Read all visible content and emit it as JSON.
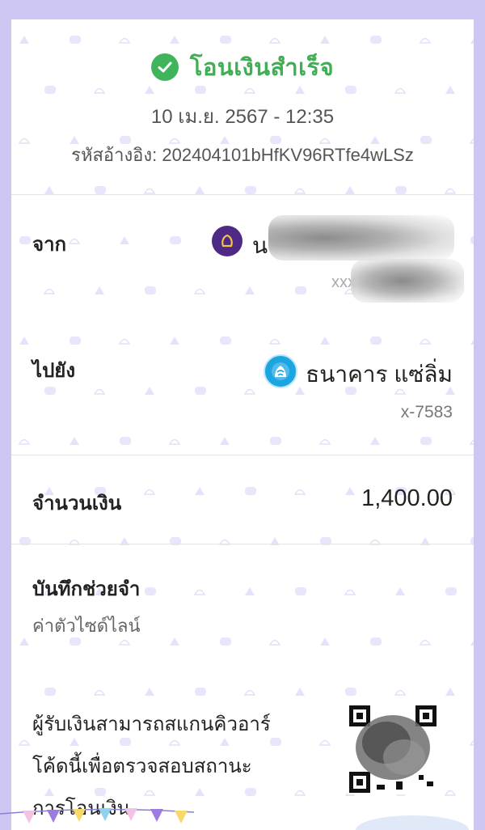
{
  "status": {
    "text": "โอนเงินสำเร็จ",
    "icon": "check-circle-icon",
    "color": "#3fae55"
  },
  "transaction": {
    "datetime": "10 เม.ย. 2567 - 12:35",
    "ref_label": "รหัสอ้างอิง:",
    "ref_code": "202404101bHfKV96RTfe4wLSz"
  },
  "from": {
    "label": "จาก",
    "bank_icon": "scb-bank-icon",
    "name_visible_prefix": "น",
    "account_masked_prefix": "xxx"
  },
  "to": {
    "label": "ไปยัง",
    "bank_icon": "krungthai-bank-icon",
    "name": "ธนาคาร แซ่ลิ่ม",
    "account": "x-7583"
  },
  "amount": {
    "label": "จำนวนเงิน",
    "value": "1,400.00"
  },
  "memo": {
    "label": "บันทึกช่วยจำ",
    "value": "ค่าตัวไซด์ไลน์"
  },
  "qr_section": {
    "lines": [
      "ผู้รับเงินสามารถสแกนคิวอาร์",
      "โค้ดนี้เพื่อตรวจสอบสถานะ",
      "การโอนเงิน"
    ],
    "icon": "qr-code-icon"
  },
  "colors": {
    "background": "#cdc6f2",
    "accent_purple": "#4e2a84",
    "success_green": "#3fb45a",
    "bank_blue": "#1ba5e1"
  }
}
